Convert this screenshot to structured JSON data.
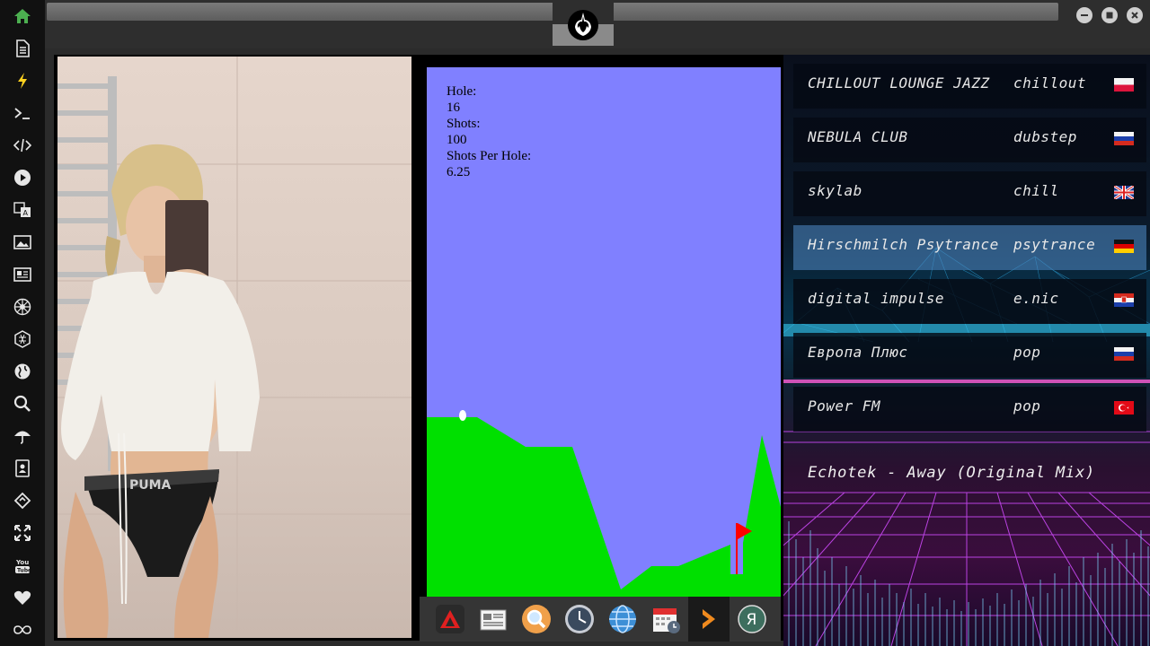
{
  "sidebar": {
    "items": [
      {
        "icon": "home-icon"
      },
      {
        "icon": "document-icon"
      },
      {
        "icon": "lightning-icon"
      },
      {
        "icon": "terminal-icon"
      },
      {
        "icon": "code-icon"
      },
      {
        "icon": "play-icon"
      },
      {
        "icon": "translate-icon"
      },
      {
        "icon": "image-icon"
      },
      {
        "icon": "news-icon"
      },
      {
        "icon": "rebel-icon"
      },
      {
        "icon": "hexagon-icon"
      },
      {
        "icon": "globe-icon"
      },
      {
        "icon": "search-icon"
      },
      {
        "icon": "umbrella-icon"
      },
      {
        "icon": "contacts-icon"
      },
      {
        "icon": "diamond-icon"
      },
      {
        "icon": "expand-icon"
      },
      {
        "icon": "youtube-icon"
      },
      {
        "icon": "heart-icon"
      },
      {
        "icon": "infinity-icon"
      }
    ],
    "accent": "#4caf50"
  },
  "game": {
    "hole_label": "Hole:",
    "hole_value": "16",
    "shots_label": "Shots:",
    "shots_value": "100",
    "sph_label": "Shots Per Hole:",
    "sph_value": "6.25",
    "sky_color": "#8080ff",
    "ground_color": "#00e000",
    "flag_color": "#ff0000"
  },
  "dock": {
    "items": [
      "app-launcher-icon",
      "news-icon",
      "search-icon",
      "clock-icon",
      "globe-icon",
      "calendar-icon",
      "arrow-icon",
      "yandex-icon"
    ]
  },
  "radio": {
    "stations": [
      {
        "name": "CHILLOUT LOUNGE JAZZ",
        "genre": "chillout",
        "flag": "poland-flag"
      },
      {
        "name": "NEBULA CLUB",
        "genre": "dubstep",
        "flag": "russia-flag"
      },
      {
        "name": "skylab",
        "genre": "chill",
        "flag": "uk-flag"
      },
      {
        "name": "Hirschmilch Psytrance",
        "genre": "psytrance",
        "flag": "germany-flag"
      },
      {
        "name": "digital impulse",
        "genre": "e.nic",
        "flag": "croatia-flag"
      },
      {
        "name": "Европа Плюс",
        "genre": "pop",
        "flag": "russia-flag"
      },
      {
        "name": "Power FM",
        "genre": "pop",
        "flag": "turkey-flag"
      }
    ],
    "now_playing": "Echotek - Away (Original Mix)"
  }
}
